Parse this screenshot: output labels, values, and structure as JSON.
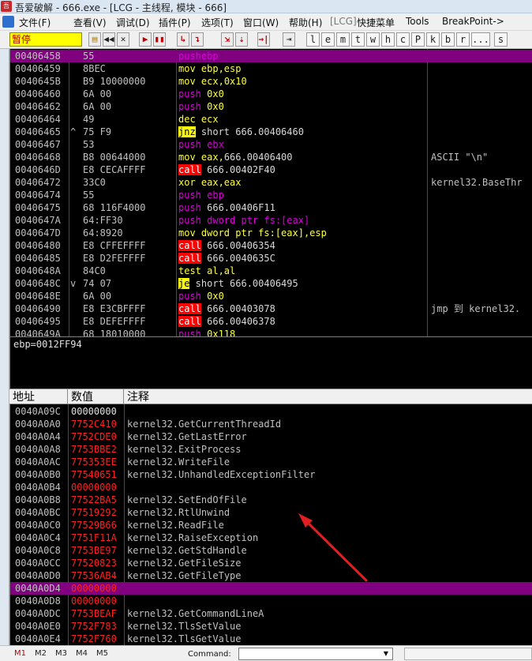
{
  "window": {
    "title": "吾爱破解 - 666.exe - [LCG - 主线程, 模块 - 666]",
    "app_icon": "52pojie-icon"
  },
  "menu": [
    "文件(F)",
    "查看(V)",
    "调试(D)",
    "插件(P)",
    "选项(T)",
    "窗口(W)",
    "帮助(H)",
    "[LCG]",
    "快捷菜单",
    "Tools",
    "BreakPoint->"
  ],
  "toolbar": {
    "status": "暂停",
    "buttons": [
      "open-icon",
      "rewind-icon",
      "close-icon",
      "play-icon",
      "pause-icon",
      "step-into-icon",
      "step-over-icon",
      "trace-into-icon",
      "trace-over-icon",
      "execute-till-return-icon",
      "goto-icon"
    ],
    "letters": [
      "l",
      "e",
      "m",
      "t",
      "w",
      "h",
      "c",
      "P",
      "k",
      "b",
      "r",
      "...",
      "s"
    ]
  },
  "cpu": {
    "rows": [
      {
        "addr": "00406458",
        "mark": "",
        "hex": "55",
        "dis": [
          [
            "push",
            "push"
          ],
          [
            "ebp",
            "push"
          ]
        ],
        "comment": "",
        "selected": true
      },
      {
        "addr": "00406459",
        "mark": "",
        "hex": "8BEC",
        "dis": [
          [
            "mov",
            "mov"
          ],
          [
            " ebp,esp",
            "mov"
          ]
        ],
        "comment": ""
      },
      {
        "addr": "0040645B",
        "mark": "",
        "hex": "B9 10000000",
        "dis": [
          [
            "mov",
            "mov"
          ],
          [
            " ecx,",
            "mov"
          ],
          [
            "0x10",
            "num"
          ]
        ],
        "comment": ""
      },
      {
        "addr": "00406460",
        "mark": "",
        "hex": "6A 00",
        "dis": [
          [
            "push",
            "push"
          ],
          [
            " 0x0",
            "pushnum"
          ]
        ],
        "comment": ""
      },
      {
        "addr": "00406462",
        "mark": "",
        "hex": "6A 00",
        "dis": [
          [
            "push",
            "push"
          ],
          [
            " 0x0",
            "pushnum"
          ]
        ],
        "comment": ""
      },
      {
        "addr": "00406464",
        "mark": "",
        "hex": "49",
        "dis": [
          [
            "dec",
            "mov"
          ],
          [
            " ecx",
            "mov"
          ]
        ],
        "comment": ""
      },
      {
        "addr": "00406465",
        "mark": "^",
        "hex": "75 F9",
        "dis": [
          [
            "jnz",
            "cond"
          ],
          [
            " short 666.00406460",
            "white"
          ]
        ],
        "comment": ""
      },
      {
        "addr": "00406467",
        "mark": "",
        "hex": "53",
        "dis": [
          [
            "push",
            "push"
          ],
          [
            " ebx",
            "push"
          ]
        ],
        "comment": ""
      },
      {
        "addr": "00406468",
        "mark": "",
        "hex": "B8 00644000",
        "dis": [
          [
            "mov",
            "mov"
          ],
          [
            " eax,",
            "mov"
          ],
          [
            "666.00406400",
            "white"
          ]
        ],
        "comment": "ASCII \"\\n\""
      },
      {
        "addr": "0040646D",
        "mark": "",
        "hex": "E8 CECAFFFF",
        "dis": [
          [
            "call",
            "call"
          ],
          [
            " 666.00402F40",
            "white"
          ]
        ],
        "comment": ""
      },
      {
        "addr": "00406472",
        "mark": "",
        "hex": "33C0",
        "dis": [
          [
            "xor",
            "mov"
          ],
          [
            " eax,eax",
            "mov"
          ]
        ],
        "comment": "kernel32.BaseThr"
      },
      {
        "addr": "00406474",
        "mark": "",
        "hex": "55",
        "dis": [
          [
            "push",
            "push"
          ],
          [
            " ebp",
            "push"
          ]
        ],
        "comment": ""
      },
      {
        "addr": "00406475",
        "mark": "",
        "hex": "68 116F4000",
        "dis": [
          [
            "push",
            "push"
          ],
          [
            " 666.00406F11",
            "white"
          ]
        ],
        "comment": ""
      },
      {
        "addr": "0040647A",
        "mark": "",
        "hex": "64:FF30",
        "dis": [
          [
            "push",
            "push"
          ],
          [
            " dword ptr fs:[eax]",
            "push"
          ]
        ],
        "comment": ""
      },
      {
        "addr": "0040647D",
        "mark": "",
        "hex": "64:8920",
        "dis": [
          [
            "mov",
            "mov"
          ],
          [
            " dword ptr fs:[eax],esp",
            "mov"
          ]
        ],
        "comment": ""
      },
      {
        "addr": "00406480",
        "mark": "",
        "hex": "E8 CFFEFFFF",
        "dis": [
          [
            "call",
            "call"
          ],
          [
            " 666.00406354",
            "white"
          ]
        ],
        "comment": ""
      },
      {
        "addr": "00406485",
        "mark": "",
        "hex": "E8 D2FEFFFF",
        "dis": [
          [
            "call",
            "call"
          ],
          [
            " 666.0040635C",
            "white"
          ]
        ],
        "comment": ""
      },
      {
        "addr": "0040648A",
        "mark": "",
        "hex": "84C0",
        "dis": [
          [
            "test",
            "mov"
          ],
          [
            " al,al",
            "mov"
          ]
        ],
        "comment": ""
      },
      {
        "addr": "0040648C",
        "mark": "v",
        "hex": "74 07",
        "dis": [
          [
            "je",
            "cond"
          ],
          [
            " short 666.00406495",
            "white"
          ]
        ],
        "comment": ""
      },
      {
        "addr": "0040648E",
        "mark": "",
        "hex": "6A 00",
        "dis": [
          [
            "push",
            "push"
          ],
          [
            " 0x0",
            "pushnum"
          ]
        ],
        "comment": ""
      },
      {
        "addr": "00406490",
        "mark": "",
        "hex": "E8 E3CBFFFF",
        "dis": [
          [
            "call",
            "call"
          ],
          [
            " 666.00403078",
            "white"
          ]
        ],
        "comment": "jmp 到 kernel32."
      },
      {
        "addr": "00406495",
        "mark": "",
        "hex": "E8 DEFEFFFF",
        "dis": [
          [
            "call",
            "call"
          ],
          [
            " 666.00406378",
            "white"
          ]
        ],
        "comment": ""
      },
      {
        "addr": "0040649A",
        "mark": "",
        "hex": "68 18010000",
        "dis": [
          [
            "push",
            "push"
          ],
          [
            " 0x118",
            "pushnum"
          ]
        ],
        "comment": ""
      }
    ]
  },
  "info": {
    "text": "ebp=0012FF94"
  },
  "dump": {
    "headers": [
      "地址",
      "数值",
      "注释"
    ],
    "rows": [
      {
        "addr": "0040A09C",
        "val": "00000000",
        "cmt": "",
        "white": true
      },
      {
        "addr": "0040A0A0",
        "val": "7752C410",
        "cmt": "kernel32.GetCurrentThreadId"
      },
      {
        "addr": "0040A0A4",
        "val": "7752CDE0",
        "cmt": "kernel32.GetLastError"
      },
      {
        "addr": "0040A0A8",
        "val": "7753BBE2",
        "cmt": "kernel32.ExitProcess"
      },
      {
        "addr": "0040A0AC",
        "val": "775353EE",
        "cmt": "kernel32.WriteFile"
      },
      {
        "addr": "0040A0B0",
        "val": "77540651",
        "cmt": "kernel32.UnhandledExceptionFilter"
      },
      {
        "addr": "0040A0B4",
        "val": "00000000",
        "cmt": ""
      },
      {
        "addr": "0040A0B8",
        "val": "77522BA5",
        "cmt": "kernel32.SetEndOfFile"
      },
      {
        "addr": "0040A0BC",
        "val": "77519292",
        "cmt": "kernel32.RtlUnwind"
      },
      {
        "addr": "0040A0C0",
        "val": "77529B66",
        "cmt": "kernel32.ReadFile"
      },
      {
        "addr": "0040A0C4",
        "val": "7751F11A",
        "cmt": "kernel32.RaiseException"
      },
      {
        "addr": "0040A0C8",
        "val": "7753BE97",
        "cmt": "kernel32.GetStdHandle"
      },
      {
        "addr": "0040A0CC",
        "val": "77520823",
        "cmt": "kernel32.GetFileSize"
      },
      {
        "addr": "0040A0D0",
        "val": "77536AB4",
        "cmt": "kernel32.GetFileType"
      },
      {
        "addr": "0040A0D4",
        "val": "00000000",
        "cmt": "",
        "selected": true
      },
      {
        "addr": "0040A0D8",
        "val": "00000000",
        "cmt": ""
      },
      {
        "addr": "0040A0DC",
        "val": "7753BEAF",
        "cmt": "kernel32.GetCommandLineA"
      },
      {
        "addr": "0040A0E0",
        "val": "7752F783",
        "cmt": "kernel32.TlsSetValue"
      },
      {
        "addr": "0040A0E4",
        "val": "7752F760",
        "cmt": "kernel32.TlsGetValue"
      }
    ]
  },
  "bottom": {
    "tabs": [
      "M1",
      "M2",
      "M3",
      "M4",
      "M5"
    ],
    "active_tab": "M1",
    "command_label": "Command:",
    "command_value": ""
  },
  "colors": {
    "selection": "#800080",
    "call_bg": "#ff0000",
    "cond_bg": "#ffff00",
    "push_text": "#d900d9",
    "mov_text": "#ffff40",
    "dump_value": "#ff2020",
    "annotation_arrow": "#e02020"
  }
}
